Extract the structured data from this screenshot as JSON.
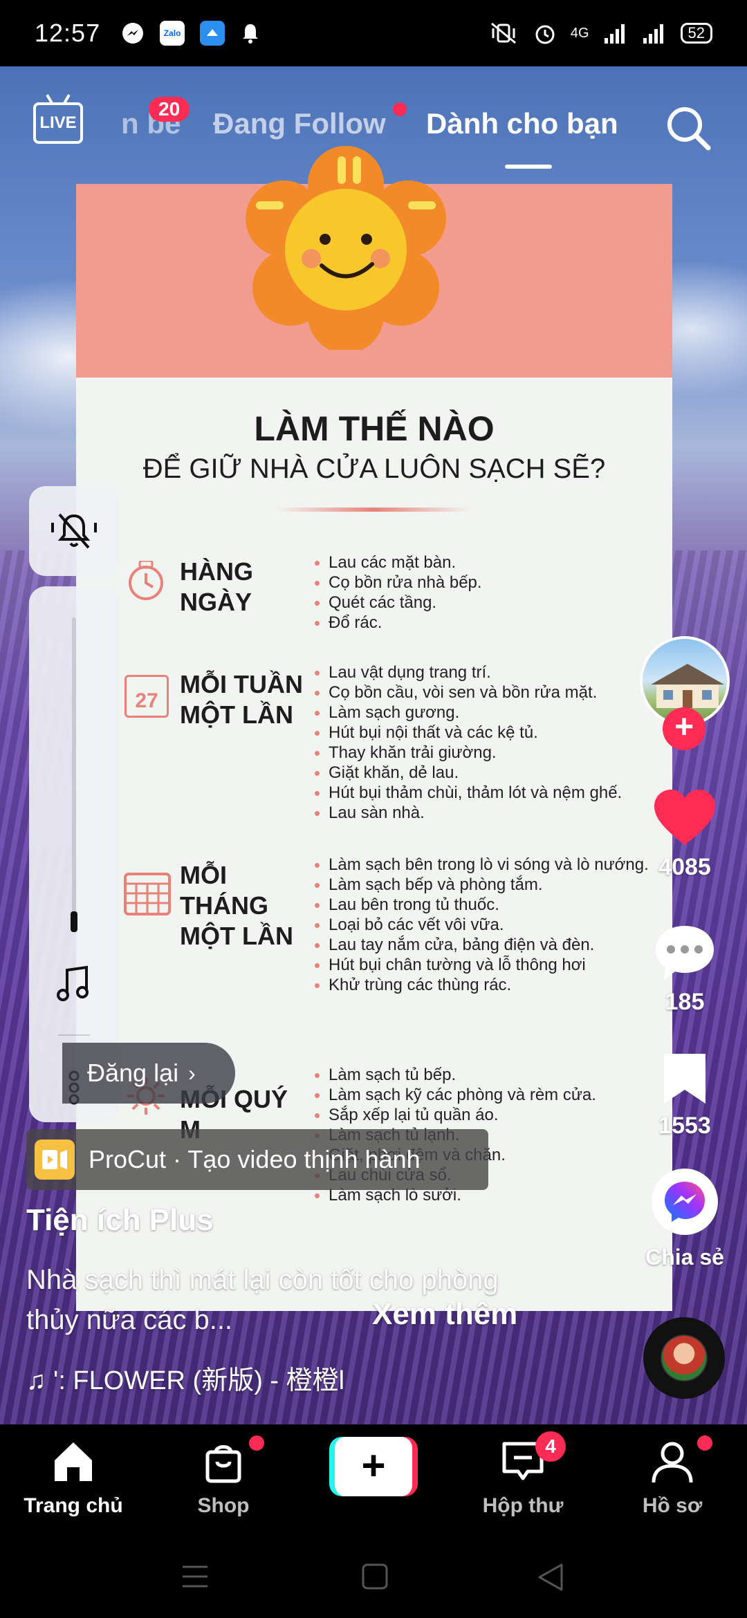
{
  "status_bar": {
    "time": "12:57",
    "app_icons": [
      "messenger-icon",
      "zalo-icon",
      "drive-icon",
      "bell-icon"
    ],
    "zalo_label": "Zalo",
    "network": "4G",
    "battery": "52"
  },
  "top_nav": {
    "live_label": "LIVE",
    "tabs": [
      {
        "label": "n bè"
      },
      {
        "label": "Đang Follow"
      },
      {
        "label": "Dành cho bạn"
      }
    ],
    "friends_badge": "20"
  },
  "infographic": {
    "title": "LÀM THẾ NÀO",
    "subtitle": "ĐỂ GIỮ NHÀ CỬA LUÔN SẠCH SẼ?",
    "sections": [
      {
        "heading": "HÀNG\nNGÀY",
        "icon": "clock-icon",
        "items": [
          "Lau các mặt bàn.",
          "Cọ bồn rửa nhà bếp.",
          "Quét các tầng.",
          "Đổ rác."
        ]
      },
      {
        "heading": "MỖI TUẦN\nMỘT LẦN",
        "icon": "calendar-icon",
        "calendar_day": "27",
        "items": [
          "Lau vật dụng trang trí.",
          "Cọ bồn cầu, vòi sen và bồn rửa mặt.",
          "Làm sạch gương.",
          "Hút bụi nội thất và các kệ tủ.",
          "Thay khăn trải giường.",
          "Giặt khăn, dẻ lau.",
          "Hút bụi thảm chùi, thảm lót và nệm ghế.",
          "Lau sàn nhà."
        ]
      },
      {
        "heading": "MỖI\nTHÁNG\nMỘT LẦN",
        "icon": "calendar-grid-icon",
        "items": [
          "Làm sạch bên trong lò vi sóng và lò nướng.",
          "Làm sạch bếp và phòng tắm.",
          "Lau bên trong tủ thuốc.",
          "Loại bỏ các vết vôi vữa.",
          "Lau tay nắm cửa, bảng điện và đèn.",
          "Hút bụi chân tường và lỗ thông hơi",
          "Khử trùng các thùng rác."
        ]
      },
      {
        "heading": "MỖI QUÝ\nM",
        "icon": "sun-icon",
        "items": [
          "Làm sạch tủ bếp.",
          "Làm sạch kỹ các phòng và rèm cửa.",
          "Sắp xếp lại tủ quần áo.",
          "Làm sạch tủ lạnh.",
          "Giặt, phơi đệm và chăn.",
          "Lau chùi cửa sổ.",
          "Làm sạch lò sưởi."
        ]
      }
    ]
  },
  "overlays": {
    "repost_label": "Đăng lại",
    "procut_label": "ProCut · Tạo video thịnh hành"
  },
  "post": {
    "author": "Tiện ích Plus",
    "caption": "Nhà sạch thì mát lại còn tốt cho phòng thủy nữa các b...",
    "see_more": "Xem thêm",
    "music": "♫ ': FLOWER (新版) - 橙橙l"
  },
  "actions": {
    "likes": "4085",
    "comments": "185",
    "saves": "1553",
    "share_label": "Chia sẻ"
  },
  "bottom_nav": {
    "items": [
      {
        "label": "Trang chủ"
      },
      {
        "label": "Shop"
      },
      {
        "label": ""
      },
      {
        "label": "Hộp thư"
      },
      {
        "label": "Hồ sơ"
      }
    ],
    "inbox_badge": "4"
  },
  "colors": {
    "accent": "#fe2c55",
    "create_left": "#25f4ee",
    "card_header": "#f29b8f",
    "bullet": "#e88278"
  }
}
